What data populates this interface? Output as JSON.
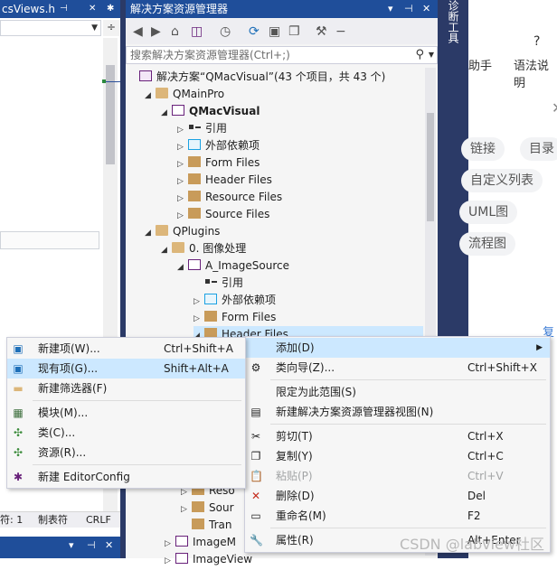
{
  "left_editor": {
    "tab_title": "csViews.h",
    "status_col": "符: 1",
    "status_tabs": "制表符",
    "status_eol": "CRLF"
  },
  "side_tool_label": "诊断工具",
  "solution_explorer": {
    "title": "解决方案资源管理器",
    "search_placeholder": "搜索解决方案资源管理器(Ctrl+;)",
    "tree": [
      {
        "label": "解决方案“QMacVisual”(43 个项目，共 43 个)",
        "icon": "solution-icon",
        "expand": "",
        "level": 0,
        "bold": false
      },
      {
        "label": "QMainPro",
        "icon": "folder-icon",
        "expand": "◢",
        "level": 1,
        "bold": false
      },
      {
        "label": "QMacVisual",
        "icon": "project-icon",
        "expand": "◢",
        "level": 2,
        "bold": true
      },
      {
        "label": "引用",
        "icon": "reference-icon",
        "expand": "▷",
        "level": 3,
        "bold": false
      },
      {
        "label": "外部依赖项",
        "icon": "external-deps-icon",
        "expand": "▷",
        "level": 3,
        "bold": false
      },
      {
        "label": "Form Files",
        "icon": "filter-icon",
        "expand": "▷",
        "level": 3,
        "bold": false
      },
      {
        "label": "Header Files",
        "icon": "filter-icon",
        "expand": "▷",
        "level": 3,
        "bold": false
      },
      {
        "label": "Resource Files",
        "icon": "filter-icon",
        "expand": "▷",
        "level": 3,
        "bold": false
      },
      {
        "label": "Source Files",
        "icon": "filter-icon",
        "expand": "▷",
        "level": 3,
        "bold": false
      },
      {
        "label": "QPlugins",
        "icon": "folder-icon",
        "expand": "◢",
        "level": 1,
        "bold": false
      },
      {
        "label": "0. 图像处理",
        "icon": "folder-icon",
        "expand": "◢",
        "level": 2,
        "bold": false
      },
      {
        "label": "A_ImageSource",
        "icon": "project-icon",
        "expand": "◢",
        "level": 3,
        "bold": false
      },
      {
        "label": "引用",
        "icon": "reference-icon",
        "expand": "",
        "level": 4,
        "bold": false
      },
      {
        "label": "外部依赖项",
        "icon": "external-deps-icon",
        "expand": "▷",
        "level": 4,
        "bold": false
      },
      {
        "label": "Form Files",
        "icon": "filter-icon",
        "expand": "▷",
        "level": 4,
        "bold": false
      },
      {
        "label": "Header Files",
        "icon": "filter-icon",
        "expand": "◢",
        "level": 4,
        "bold": false
      }
    ],
    "tree_bottom": [
      {
        "label": "Reso",
        "icon": "filter-icon",
        "expand": "▷"
      },
      {
        "label": "Sour",
        "icon": "filter-icon",
        "expand": "▷"
      },
      {
        "label": "Tran",
        "icon": "filter-icon",
        "expand": ""
      },
      {
        "label": "ImageM",
        "icon": "project-icon",
        "expand": "▷"
      },
      {
        "label": "ImageView",
        "icon": "project-icon",
        "expand": "▷"
      }
    ]
  },
  "right_pane": {
    "help_label": "助手",
    "grammar_label": "语法说明",
    "chips": [
      "链接",
      "目录",
      "自定义列表",
      "UML图",
      "流程图"
    ],
    "side_letter": "复"
  },
  "context_menu": [
    {
      "label": "添加(D)",
      "shortcut": "",
      "icon": "",
      "submenu": true,
      "disabled": false,
      "hover": true
    },
    {
      "label": "类向导(Z)...",
      "shortcut": "Ctrl+Shift+X",
      "icon": "class-wizard-icon",
      "disabled": false
    },
    {
      "sep": true
    },
    {
      "label": "限定为此范围(S)",
      "shortcut": "",
      "icon": "",
      "disabled": false
    },
    {
      "label": "新建解决方案资源管理器视图(N)",
      "shortcut": "",
      "icon": "new-view-icon",
      "disabled": false
    },
    {
      "sep": true
    },
    {
      "label": "剪切(T)",
      "shortcut": "Ctrl+X",
      "icon": "scissors-icon",
      "disabled": false
    },
    {
      "label": "复制(Y)",
      "shortcut": "Ctrl+C",
      "icon": "copy-icon",
      "disabled": false
    },
    {
      "label": "粘贴(P)",
      "shortcut": "Ctrl+V",
      "icon": "paste-icon",
      "disabled": true
    },
    {
      "label": "删除(D)",
      "shortcut": "Del",
      "icon": "delete-icon",
      "disabled": false
    },
    {
      "label": "重命名(M)",
      "shortcut": "F2",
      "icon": "rename-icon",
      "disabled": false
    },
    {
      "sep": true
    },
    {
      "label": "属性(R)",
      "shortcut": "Alt+Enter",
      "icon": "wrench-icon",
      "disabled": false
    }
  ],
  "add_submenu": [
    {
      "label": "新建项(W)...",
      "shortcut": "Ctrl+Shift+A",
      "icon": "new-item-icon",
      "hover": false
    },
    {
      "label": "现有项(G)...",
      "shortcut": "Shift+Alt+A",
      "icon": "existing-item-icon",
      "hover": true
    },
    {
      "label": "新建筛选器(F)",
      "shortcut": "",
      "icon": "new-filter-icon",
      "hover": false
    },
    {
      "sep": true
    },
    {
      "label": "模块(M)...",
      "shortcut": "",
      "icon": "module-icon",
      "hover": false
    },
    {
      "label": "类(C)...",
      "shortcut": "",
      "icon": "class-icon",
      "hover": false
    },
    {
      "label": "资源(R)...",
      "shortcut": "",
      "icon": "resource-icon",
      "hover": false
    },
    {
      "sep": true
    },
    {
      "label": "新建 EditorConfig",
      "shortcut": "",
      "icon": "editorconfig-icon",
      "hover": false
    }
  ],
  "watermark": "CSDN @labview社区"
}
